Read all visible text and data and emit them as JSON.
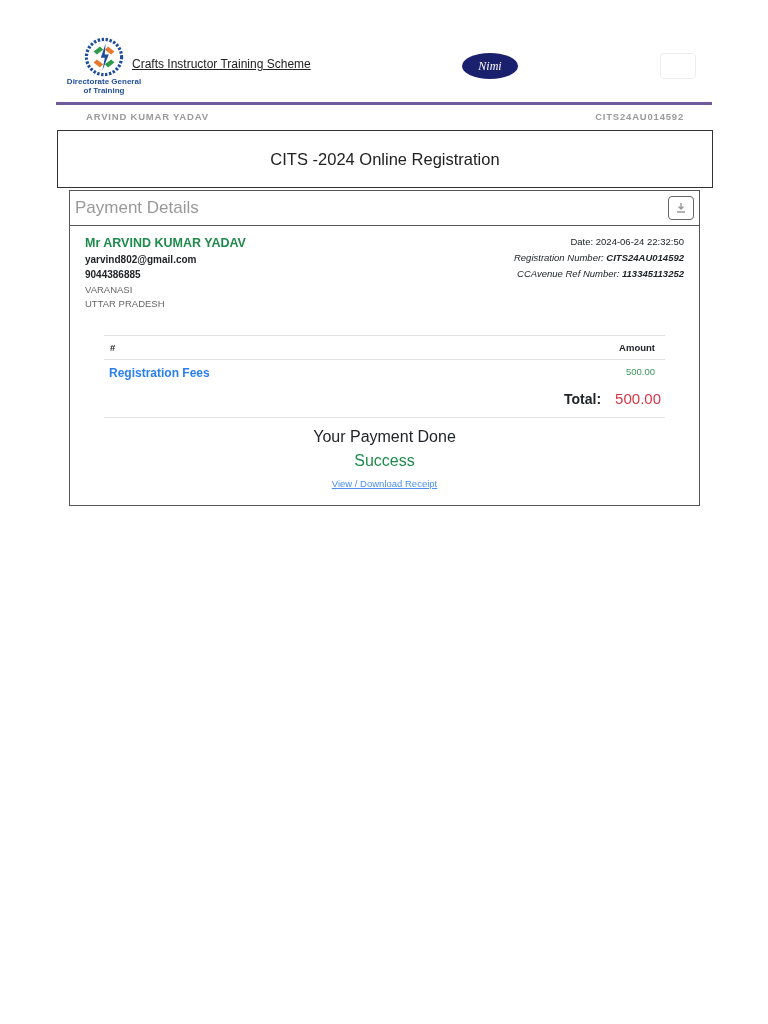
{
  "header": {
    "logo_caption": "Directorate General of Training",
    "site_title": "Crafts Instructor Training Scheme",
    "partner_logo_text": "Nimi"
  },
  "user_bar": {
    "name": "ARVIND KUMAR YADAV",
    "registration_id": "CITS24AU014592"
  },
  "page_title": "CITS -2024 Online Registration",
  "panel": {
    "title": "Payment Details",
    "customer": {
      "name": "Mr ARVIND KUMAR YADAV",
      "email": "yarvind802@gmail.com",
      "phone": "9044386885",
      "address_lines": [
        "VARANASI",
        "UTTAR PRADESH"
      ]
    },
    "meta": [
      {
        "kind": "plain",
        "text": "Date: 2024-06-24 22:32:50"
      },
      {
        "kind": "italic",
        "text": "Registration Number: **CITS24AU014592**"
      },
      {
        "kind": "italic",
        "text": "CCAvenue Ref Number: **113345113252**"
      }
    ],
    "table": {
      "columns": [
        "#",
        "Amount"
      ],
      "rows": [
        {
          "item": "Registration Fees",
          "amount": "500.00"
        }
      ]
    },
    "total_label": "Total:",
    "total_value": "500.00",
    "status_heading": "Your Payment Done",
    "status": "Success",
    "receipt_link": "View / Download Receipt"
  }
}
